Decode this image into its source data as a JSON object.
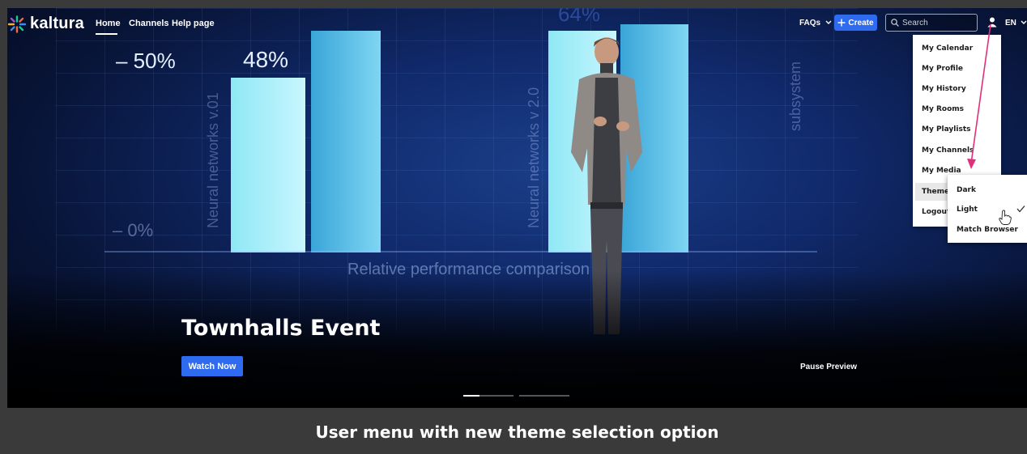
{
  "nav": {
    "logo": "kaltura",
    "links": [
      "Home",
      "Channels",
      "Help page"
    ],
    "faqs": "FAQs",
    "create": "Create",
    "search_placeholder": "Search",
    "language": "EN"
  },
  "hero": {
    "background_numbers": [
      "– 50%",
      "48%",
      "64%",
      "– 0%"
    ],
    "background_labels": [
      "Neural networks v.01",
      "Neural networks v 2.0",
      "subsystem"
    ],
    "background_caption": "Relative performance comparison",
    "title": "Townhalls Event",
    "watch_button": "Watch Now",
    "pause_preview": "Pause Preview",
    "carousel": {
      "count": 2,
      "active_index": 0
    }
  },
  "user_menu": {
    "items": [
      "My Calendar",
      "My Profile",
      "My History",
      "My Rooms",
      "My Playlists",
      "My Channels",
      "My Media",
      "Theme",
      "Logout"
    ],
    "active_item": "Theme",
    "theme_options": [
      "Dark",
      "Light",
      "Match Browser"
    ],
    "selected_theme": "Light"
  },
  "caption": "User menu with new theme selection option",
  "colors": {
    "accent": "#2e6bf0",
    "annotation_arrow": "#e0307a",
    "caption_bg": "#3a3a3a"
  },
  "icons": [
    "kaltura-logo-icon",
    "plus-icon",
    "search-icon",
    "user-icon",
    "chevron-down-icon",
    "check-icon",
    "hand-cursor-icon"
  ]
}
